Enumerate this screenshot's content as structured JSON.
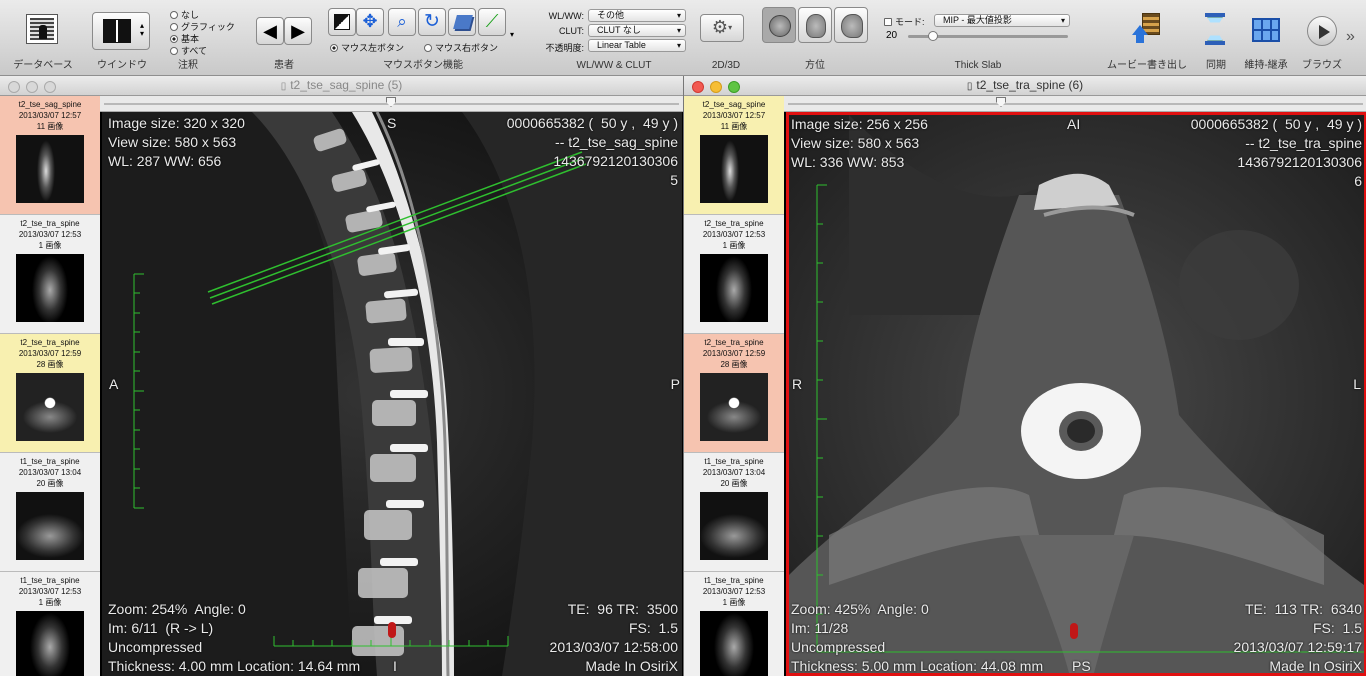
{
  "toolbar": {
    "database": "データベース",
    "window": "ウインドウ",
    "annotation": {
      "label": "注釈",
      "options": [
        "なし",
        "グラフィック",
        "基本",
        "すべて"
      ],
      "selected_index": 2
    },
    "patient": "患者",
    "mouse_function": {
      "label": "マウスボタン機能",
      "left": "マウス左ボタン",
      "right": "マウス右ボタン"
    },
    "wlww": {
      "label": "WL/WW & CLUT",
      "wlww_key": "WL/WW:",
      "wlww_value": "その他",
      "clut_key": "CLUT:",
      "clut_value": "CLUT なし",
      "opacity_key": "不透明度:",
      "opacity_value": "Linear Table"
    },
    "settings_icon": "gear-icon",
    "d2d3": "2D/3D",
    "orientation": "方位",
    "thickslab": {
      "label": "Thick Slab",
      "mode_key": "モード:",
      "mode_value": "MIP - 最大値投影",
      "value": "20"
    },
    "movie_export": "ムービー書き出し",
    "sync": "同期",
    "keep": "維持-継承",
    "browse": "ブラウズ"
  },
  "colors": {
    "active_border": "#e01010",
    "measure_green": "#2fbf2f",
    "thumb_selected": "#f6c4b0",
    "thumb_highlight": "#f8f0b0"
  },
  "series": [
    {
      "name": "t2_tse_sag_spine",
      "date": "2013/03/07 12:57",
      "count": "11 画像"
    },
    {
      "name": "t2_tse_tra_spine",
      "date": "2013/03/07 12:53",
      "count": "1 画像"
    },
    {
      "name": "t2_tse_tra_spine",
      "date": "2013/03/07 12:59",
      "count": "28 画像"
    },
    {
      "name": "t1_tse_tra_spine",
      "date": "2013/03/07 13:04",
      "count": "20 画像"
    },
    {
      "name": "t1_tse_tra_spine",
      "date": "2013/03/07 12:53",
      "count": "1 画像"
    }
  ],
  "viewer_left": {
    "title": "t2_tse_sag_spine (5)",
    "tl": "Image size: 320 x 320\nView size: 580 x 563\nWL: 287 WW: 656",
    "tr": "0000665382 (  50 y ,  49 y )\n-- t2_tse_sag_spine\n1436792120130306\n5",
    "bl": "Zoom: 254%  Angle: 0\nIm: 6/11  (R -> L)\nUncompressed\nThickness: 4.00 mm Location: 14.64 mm",
    "br": "TE:  96 TR:  3500\nFS:  1.5\n2013/03/07 12:58:00\nMade In OsiriX",
    "top": "S",
    "left": "A",
    "right": "P",
    "bottom": "I"
  },
  "viewer_right": {
    "title": "t2_tse_tra_spine (6)",
    "tl": "Image size: 256 x 256\nView size: 580 x 563\nWL: 336 WW: 853",
    "tr": "0000665382 (  50 y ,  49 y )\n-- t2_tse_tra_spine\n1436792120130306\n6",
    "bl": "Zoom: 425%  Angle: 0\nIm: 11/28\nUncompressed\nThickness: 5.00 mm Location: 44.08 mm",
    "br": "TE:  113 TR:  6340\nFS:  1.5\n2013/03/07 12:59:17\nMade In OsiriX",
    "top": "AI",
    "left": "R",
    "right": "L",
    "bottom": "PS"
  }
}
